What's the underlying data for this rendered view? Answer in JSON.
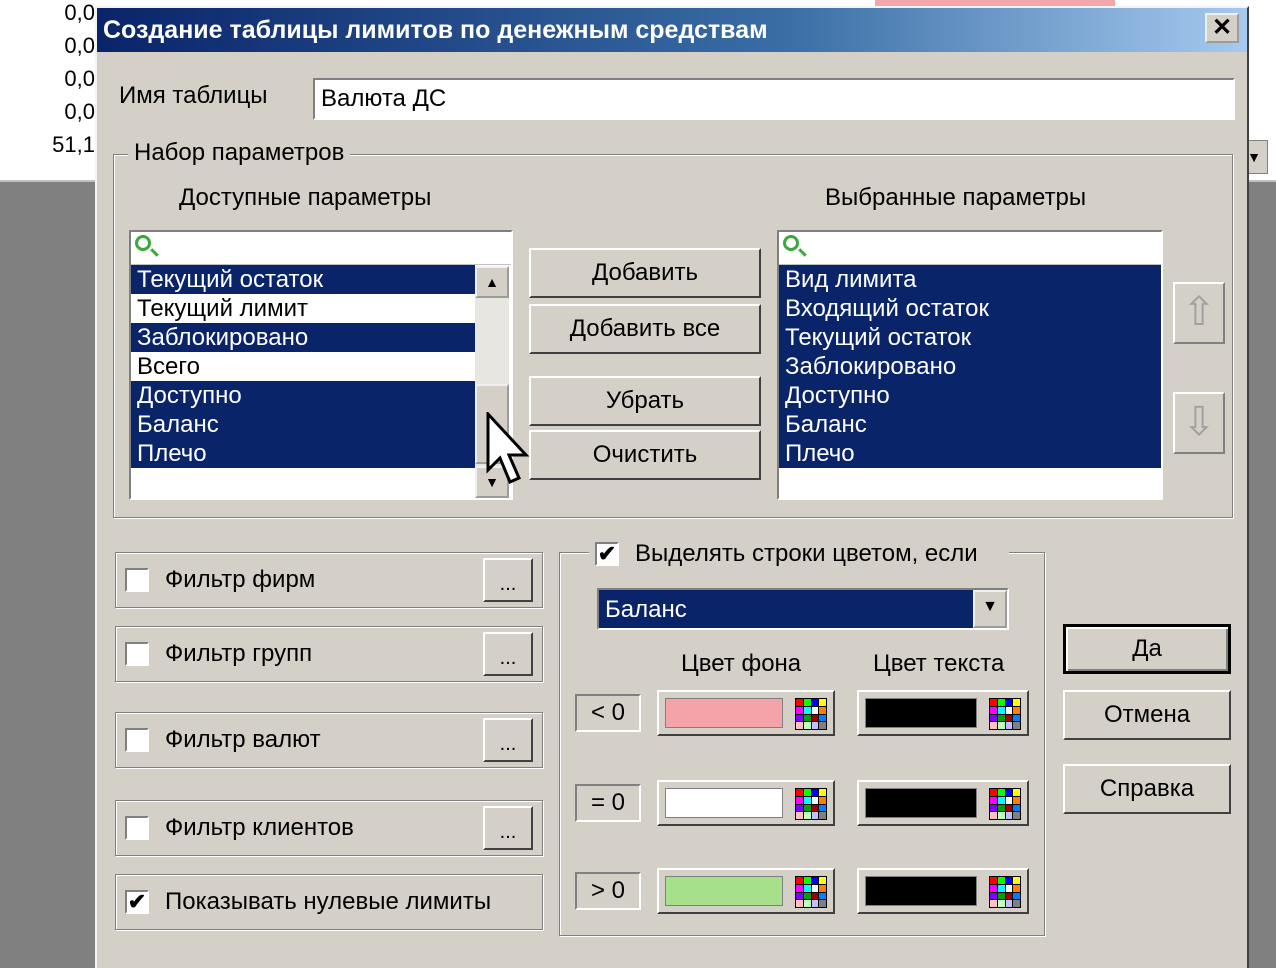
{
  "background": {
    "numbers": [
      "0,0",
      "0,0",
      "0,0",
      "0,0",
      "51,1"
    ]
  },
  "dialog": {
    "title": "Создание таблицы лимитов по денежным средствам",
    "close_label": "✕",
    "table_name_label": "Имя таблицы",
    "table_name_value": "Валюта ДС",
    "param_group_title": "Набор параметров",
    "available_title": "Доступные параметры",
    "selected_title": "Выбранные параметры",
    "available_items": [
      {
        "label": "Текущий остаток",
        "selected": true
      },
      {
        "label": "Текущий лимит",
        "selected": false
      },
      {
        "label": "Заблокировано",
        "selected": true
      },
      {
        "label": "Всего",
        "selected": false
      },
      {
        "label": "Доступно",
        "selected": true
      },
      {
        "label": "Баланс",
        "selected": true
      },
      {
        "label": "Плечо",
        "selected": true
      }
    ],
    "selected_items": [
      {
        "label": "Вид лимита"
      },
      {
        "label": "Входящий остаток"
      },
      {
        "label": "Текущий остаток"
      },
      {
        "label": "Заблокировано"
      },
      {
        "label": "Доступно"
      },
      {
        "label": "Баланс"
      },
      {
        "label": "Плечо"
      }
    ],
    "buttons": {
      "add": "Добавить",
      "add_all": "Добавить все",
      "remove": "Убрать",
      "clear": "Очистить",
      "ok": "Да",
      "cancel": "Отмена",
      "help": "Справка",
      "ellipsis": "..."
    },
    "filters": [
      {
        "label": "Фильтр фирм",
        "checked": false
      },
      {
        "label": "Фильтр групп",
        "checked": false
      },
      {
        "label": "Фильтр валют",
        "checked": false
      },
      {
        "label": "Фильтр клиентов",
        "checked": false
      }
    ],
    "show_zero_limits": {
      "label": "Показывать нулевые лимиты",
      "checked": true
    },
    "highlight": {
      "label": "Выделять строки цветом, если",
      "checked": true,
      "field_value": "Баланс",
      "bg_header": "Цвет фона",
      "text_header": "Цвет текста",
      "rows": [
        {
          "condition": "< 0",
          "bg_color": "#f4a3a8",
          "text_color": "#000000"
        },
        {
          "condition": "= 0",
          "bg_color": "#ffffff",
          "text_color": "#000000"
        },
        {
          "condition": "> 0",
          "bg_color": "#a6e08a",
          "text_color": "#000000"
        }
      ]
    },
    "check_mark": "✔"
  }
}
